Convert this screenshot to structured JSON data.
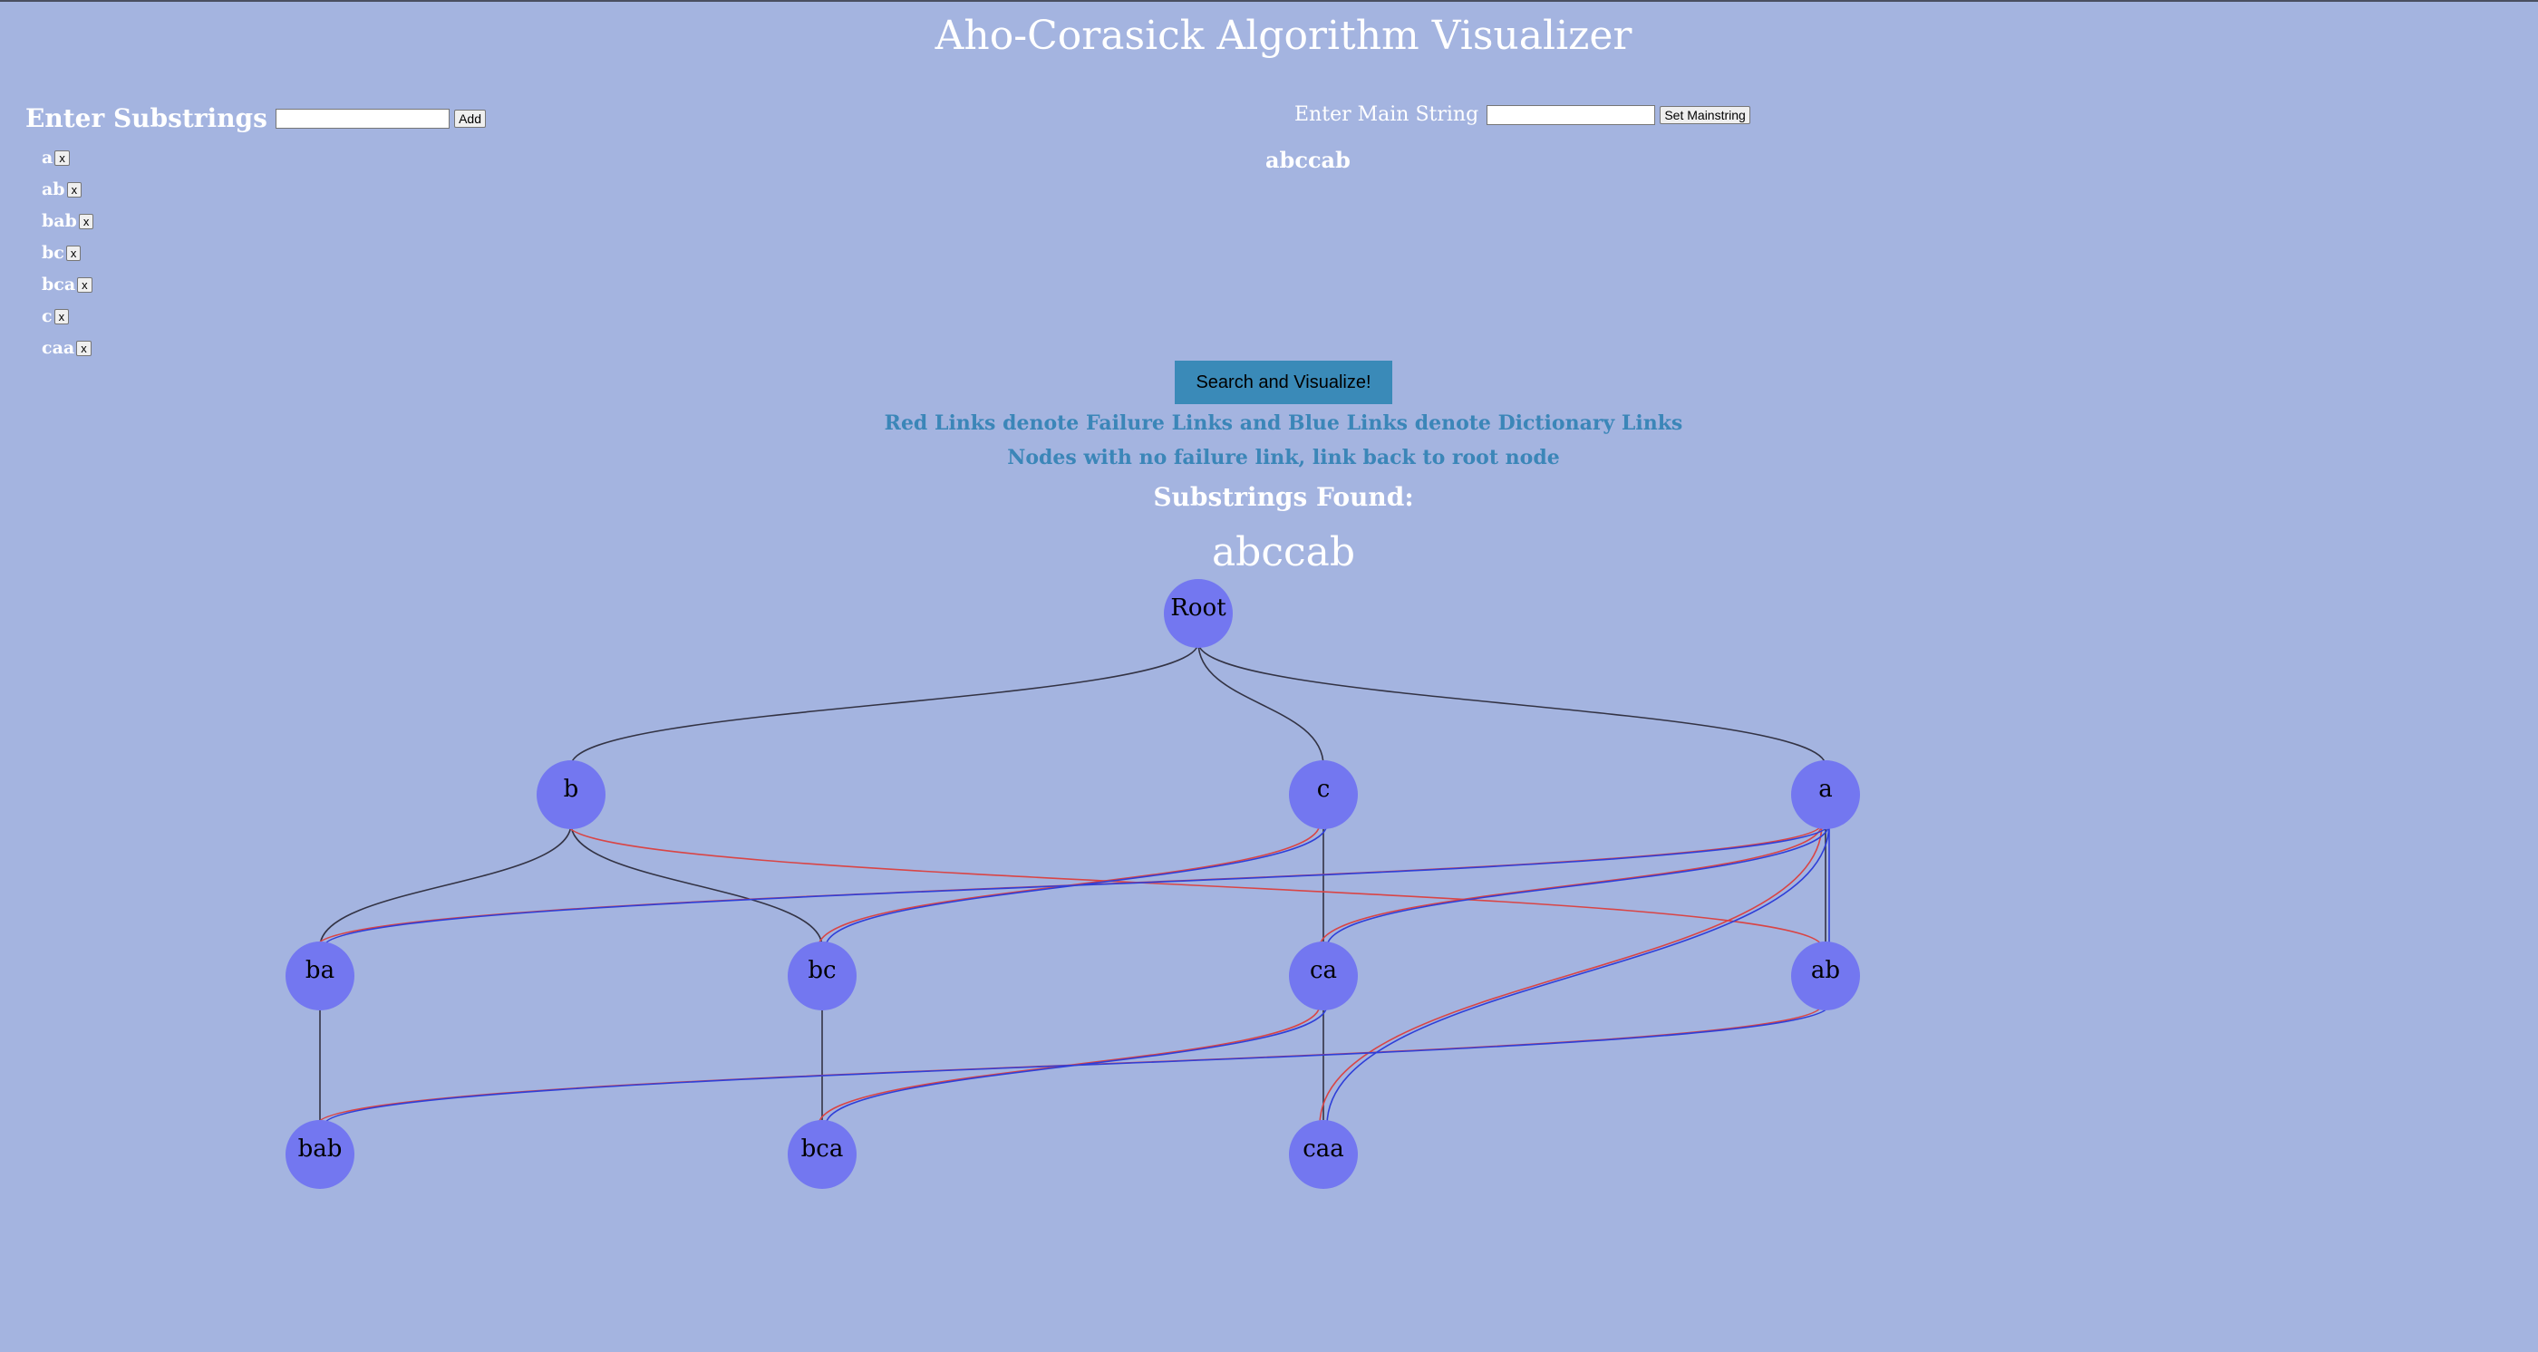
{
  "title": "Aho-Corasick Algorithm Visualizer",
  "substrings": {
    "heading": "Enter Substrings",
    "add_label": "Add",
    "input_value": "",
    "remove_label": "x",
    "items": [
      "a",
      "ab",
      "bab",
      "bc",
      "bca",
      "c",
      "caa"
    ]
  },
  "main_string": {
    "label": "Enter Main String",
    "button_label": "Set Mainstring",
    "input_value": "",
    "current": "abccab"
  },
  "search_button_label": "Search and Visualize!",
  "legend": {
    "line1": "Red Links denote Failure Links and Blue Links denote Dictionary Links",
    "line2": "Nodes with no failure link, link back to root node"
  },
  "found": {
    "heading": "Substrings Found:",
    "text": "abccab"
  },
  "colors": {
    "background": "#a4b4e0",
    "node_fill": "#7377f0",
    "tree_edge": "#333344",
    "failure_link": "#d94545",
    "dictionary_link": "#2f3fd8",
    "info_text": "#3b86b8",
    "button": "#3a8ab8"
  },
  "trie": {
    "nodes": [
      "Root",
      "b",
      "c",
      "a",
      "ba",
      "bc",
      "ca",
      "ab",
      "bab",
      "bca",
      "caa"
    ],
    "tree_edges": [
      [
        "Root",
        "b"
      ],
      [
        "Root",
        "c"
      ],
      [
        "Root",
        "a"
      ],
      [
        "b",
        "ba"
      ],
      [
        "b",
        "bc"
      ],
      [
        "c",
        "ca"
      ],
      [
        "a",
        "ab"
      ],
      [
        "ba",
        "bab"
      ],
      [
        "bc",
        "bca"
      ],
      [
        "ca",
        "caa"
      ]
    ],
    "failure_links": [
      [
        "ab",
        "b"
      ],
      [
        "ba",
        "a"
      ],
      [
        "bc",
        "c"
      ],
      [
        "ca",
        "a"
      ],
      [
        "bab",
        "ab"
      ],
      [
        "bca",
        "ca"
      ],
      [
        "caa",
        "a"
      ]
    ],
    "dictionary_links": [
      [
        "ba",
        "a"
      ],
      [
        "bc",
        "c"
      ],
      [
        "ca",
        "a"
      ],
      [
        "ab",
        "a"
      ],
      [
        "bab",
        "ab"
      ],
      [
        "bca",
        "ca"
      ],
      [
        "caa",
        "a"
      ]
    ]
  }
}
